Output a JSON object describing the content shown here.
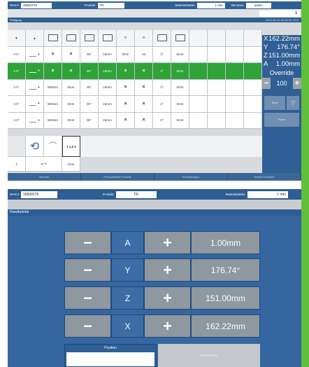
{
  "screen1": {
    "header": {
      "maku_label": "MAKU",
      "maku_value": "18500275",
      "produkt_label": "Produkt",
      "produkt_value": "TR",
      "material_label": "Materialstärke",
      "material_value": "1 mm",
      "benutzer_label": "Benutzer",
      "benutzer_value": "admin"
    },
    "counter": "1",
    "section_title": "Fertigung",
    "timestamp": "2022-03-10 06:25:06   7000",
    "rows": [
      {
        "num": "0",
        "sub": "0°",
        "c4": "90°",
        "c5": "15mm",
        "c6": "0mm",
        "c7": "15",
        "c8": "3°",
        "c9": "0mm"
      },
      {
        "num": "1",
        "sub": "0°",
        "c4": "90°",
        "c5": "15mm",
        "c8": "3°",
        "c9": "0mm"
      },
      {
        "num": "2",
        "sub": "0°",
        "c2": "500mm",
        "c3": "0mm",
        "c4": "90°",
        "c5": "15mm",
        "c8": "3°",
        "c9": "0mm"
      },
      {
        "num": "3",
        "sub": "0°",
        "c2": "500mm",
        "c3": "0mm",
        "c4": "90°",
        "c5": "15mm",
        "c8": "3°",
        "c9": "0mm"
      },
      {
        "num": "4",
        "sub": "0°",
        "c2": "500mm",
        "c3": "0mm",
        "c4": "90°",
        "c5": "15mm",
        "c8": "3°",
        "c9": "0mm"
      }
    ],
    "axes": [
      {
        "axis": "X",
        "value": "162.22mm"
      },
      {
        "axis": "Y",
        "value": "176.74°"
      },
      {
        "axis": "Z",
        "value": "151.00mm"
      },
      {
        "axis": "A",
        "value": "1.00mm"
      }
    ],
    "override_label": "Override",
    "override_value": "100",
    "start_label": "Start",
    "reset_label": "Reset",
    "bottom_row": {
      "num": "1",
      "sub": "0°",
      "val": "2mm"
    },
    "tool_label": "1 1,5 2",
    "tabs": [
      "Manuell",
      "Personalisiert Produkt",
      "Einstellungen",
      "Neues Dreickteil"
    ]
  },
  "screen2": {
    "header": {
      "maku_label": "MAKU",
      "maku_value": "18500275",
      "produkt_label": "Produkt",
      "produkt_value": "TR",
      "material_label": "Materialstärke",
      "material_value": "1 mm"
    },
    "section_title": "Handbetrieb",
    "axes": [
      {
        "axis": "A",
        "value": "1.00mm"
      },
      {
        "axis": "Y",
        "value": "176.74°"
      },
      {
        "axis": "Z",
        "value": "151.00mm"
      },
      {
        "axis": "X",
        "value": "162.22mm"
      }
    ],
    "minus": "−",
    "plus": "+",
    "position_label": "Position",
    "ziel_label": "Ziel anfahren"
  },
  "colors": {
    "accent_blue": "#2f5f94",
    "selected_green": "#2fa338",
    "side_green": "#63be3c",
    "button_grey": "#8f979f"
  }
}
